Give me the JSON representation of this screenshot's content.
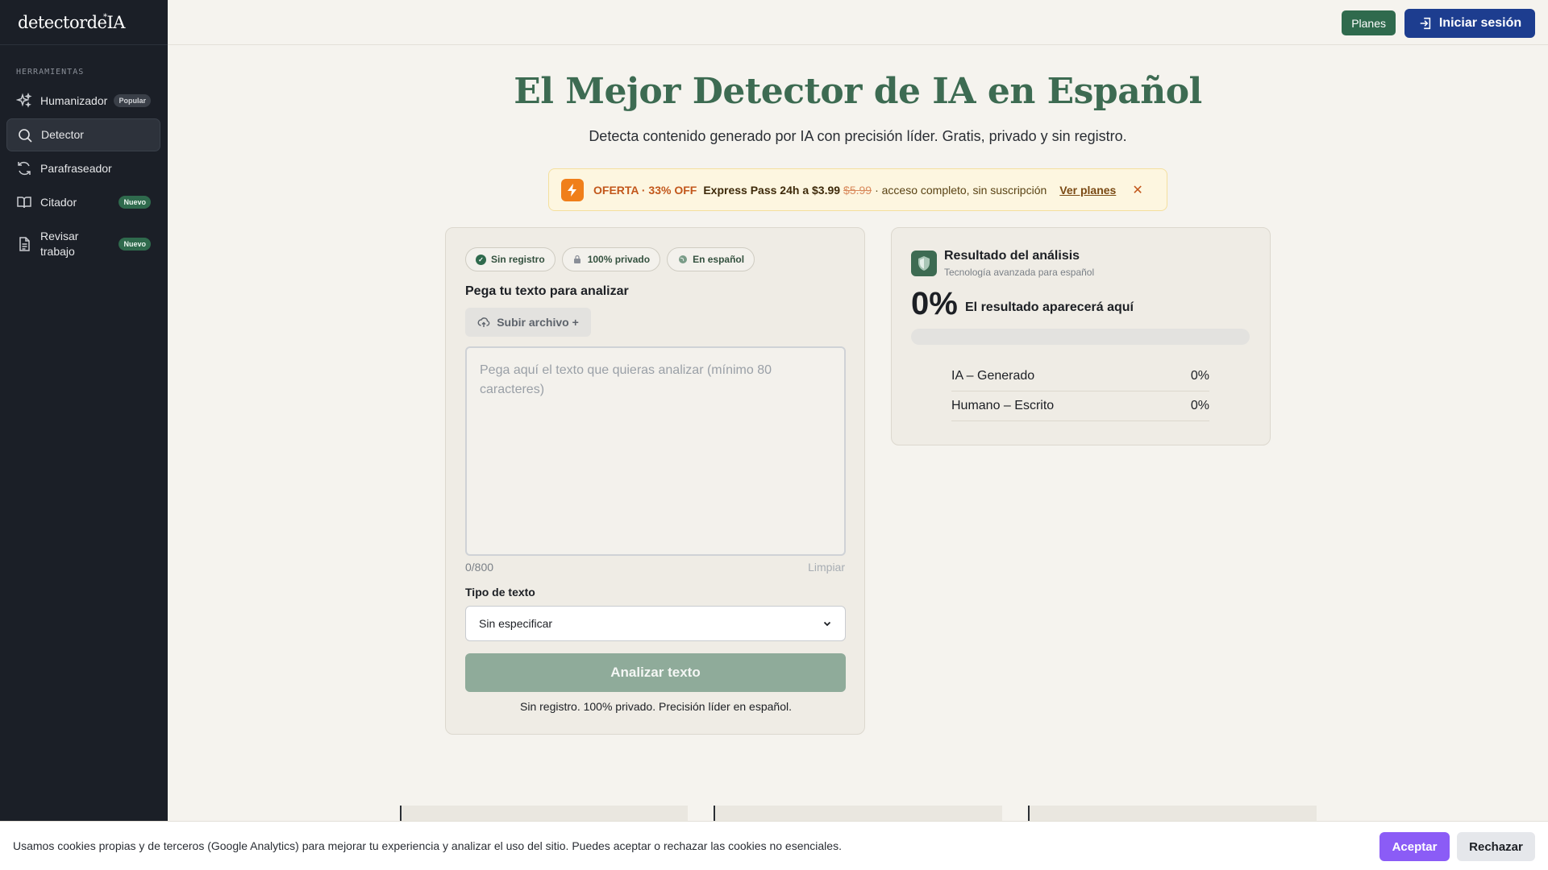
{
  "app": {
    "logo_text": "detectordeIA",
    "logo_mark": "*"
  },
  "sidebar": {
    "section_label": "HERRAMIENTAS",
    "items": [
      {
        "label": "Humanizador",
        "badge": "Popular",
        "icon": "sparkles-icon",
        "active": false
      },
      {
        "label": "Detector",
        "badge": "",
        "icon": "search-icon",
        "active": true
      },
      {
        "label": "Parafraseador",
        "badge": "",
        "icon": "refresh-icon",
        "active": false
      },
      {
        "label": "Citador",
        "badge": "Nuevo",
        "icon": "book-icon",
        "active": false
      },
      {
        "label": "Revisar\ntrabajo",
        "badge": "Nuevo",
        "icon": "document-icon",
        "active": false
      }
    ]
  },
  "topbar": {
    "planes_label": "Planes",
    "login_label": "Iniciar sesión"
  },
  "hero": {
    "title": "El Mejor Detector de IA en Español",
    "subtitle": "Detecta contenido generado por IA con precisión líder. Gratis, privado y sin registro."
  },
  "offer": {
    "tag": "OFERTA · 33% OFF",
    "express": "Express Pass 24h a $3.99",
    "old_price": "$5.99",
    "rest": "· acceso completo, sin suscripción",
    "link": "Ver planes",
    "close": "✕"
  },
  "input_card": {
    "pills": [
      {
        "label": "Sin registro",
        "icon": "check-circle-icon"
      },
      {
        "label": "100% privado",
        "icon": "lock-icon"
      },
      {
        "label": "En español",
        "icon": "globe-icon"
      }
    ],
    "paste_label": "Pega tu texto para analizar",
    "upload_label": "Subir archivo +",
    "textarea_value": "",
    "textarea_placeholder": "Pega aquí el texto que quieras analizar (mínimo 80 caracteres)",
    "count": "0/800",
    "clear_label": "Limpiar",
    "type_label": "Tipo de texto",
    "type_selected": "Sin especificar",
    "analyze_label": "Analizar texto",
    "footnote": "Sin registro. 100% privado. Precisión líder en español."
  },
  "result_card": {
    "title": "Resultado del análisis",
    "subtitle": "Tecnología avanzada para español",
    "percent": "0%",
    "message": "El resultado aparecerá aquí",
    "progress_fraction": 0,
    "rows": [
      {
        "label": "IA – Generado",
        "value": "0%"
      },
      {
        "label": "Humano – Escrito",
        "value": "0%"
      }
    ]
  },
  "cookie": {
    "text": "Usamos cookies propias y de terceros (Google Analytics) para mejorar tu experiencia y analizar el uso del sitio. Puedes aceptar o rechazar las cookies no esenciales.",
    "accept_label": "Aceptar",
    "reject_label": "Rechazar"
  },
  "colors": {
    "brand_green": "#3d6b52",
    "login_blue": "#1d3d8f",
    "accept_purple": "#8b5cf6",
    "offer_orange": "#f07f1a"
  }
}
